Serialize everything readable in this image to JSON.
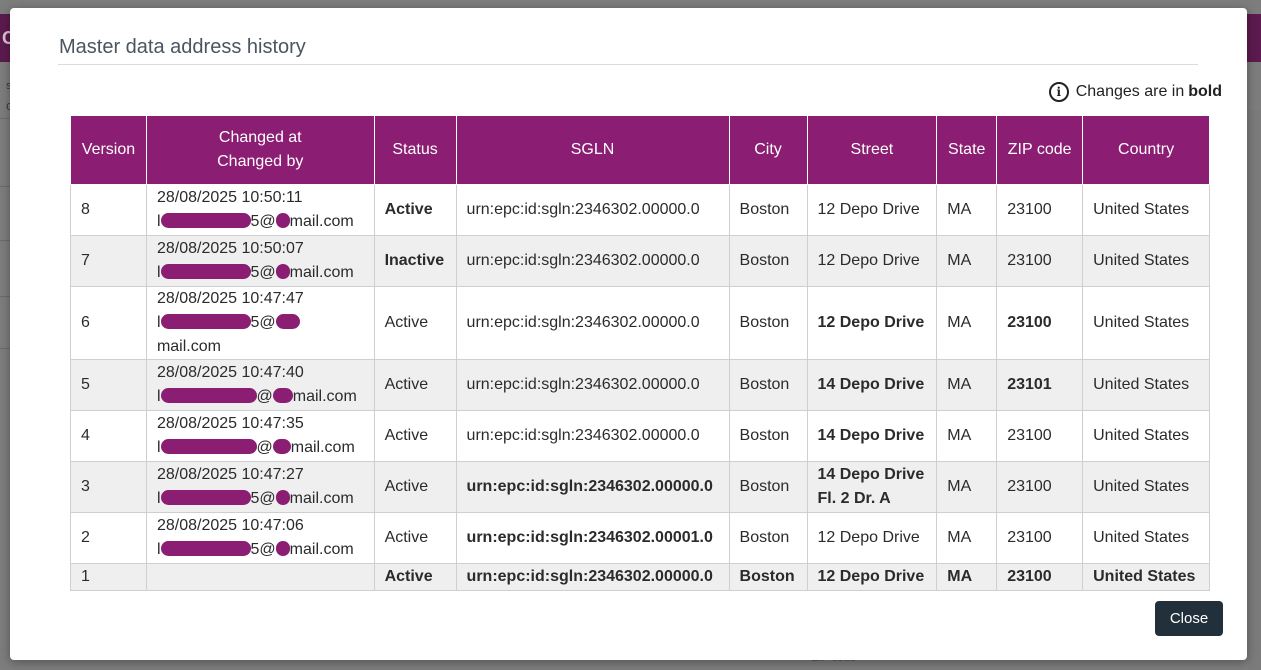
{
  "modal": {
    "title": "Master data address history",
    "legend_prefix": "Changes are in",
    "legend_bold": "bold",
    "close_label": "Close"
  },
  "background": {
    "header_letter": "C",
    "label_s": "s",
    "label_c": "c",
    "bottom_text": "ZIP code"
  },
  "table": {
    "headers": {
      "version": "Version",
      "changed_at": "Changed at",
      "changed_by": "Changed by",
      "status": "Status",
      "sgln": "SGLN",
      "city": "City",
      "street": "Street",
      "state": "State",
      "zip": "ZIP code",
      "country": "Country"
    },
    "rows": [
      {
        "version": "8",
        "changed_at": "28/08/2025 10:50:11",
        "changed_by_prefix": "l",
        "changed_by_suffix": "5@",
        "changed_by_domain": "mail.com",
        "status": "Active",
        "sgln": "urn:epc:id:sgln:2346302.00000.0",
        "city": "Boston",
        "street": "12 Depo Drive",
        "street2": "",
        "state": "MA",
        "zip": "23100",
        "country": "United States"
      },
      {
        "version": "7",
        "changed_at": "28/08/2025 10:50:07",
        "changed_by_prefix": "l",
        "changed_by_suffix": "5@",
        "changed_by_domain": "mail.com",
        "status": "Inactive",
        "sgln": "urn:epc:id:sgln:2346302.00000.0",
        "city": "Boston",
        "street": "12 Depo Drive",
        "street2": "",
        "state": "MA",
        "zip": "23100",
        "country": "United States"
      },
      {
        "version": "6",
        "changed_at": "28/08/2025 10:47:47",
        "changed_by_prefix": "l",
        "changed_by_suffix": "5@",
        "changed_by_domain": "mail.com",
        "status": "Active",
        "sgln": "urn:epc:id:sgln:2346302.00000.0",
        "city": "Boston",
        "street": "12 Depo Drive",
        "street2": "",
        "state": "MA",
        "zip": "23100",
        "country": "United States"
      },
      {
        "version": "5",
        "changed_at": "28/08/2025 10:47:40",
        "changed_by_prefix": "l",
        "changed_by_suffix": "@",
        "changed_by_domain": "mail.com",
        "status": "Active",
        "sgln": "urn:epc:id:sgln:2346302.00000.0",
        "city": "Boston",
        "street": "14 Depo Drive",
        "street2": "",
        "state": "MA",
        "zip": "23101",
        "country": "United States"
      },
      {
        "version": "4",
        "changed_at": "28/08/2025 10:47:35",
        "changed_by_prefix": "l",
        "changed_by_suffix": "@",
        "changed_by_domain": "mail.com",
        "status": "Active",
        "sgln": "urn:epc:id:sgln:2346302.00000.0",
        "city": "Boston",
        "street": "14 Depo Drive",
        "street2": "",
        "state": "MA",
        "zip": "23100",
        "country": "United States"
      },
      {
        "version": "3",
        "changed_at": "28/08/2025 10:47:27",
        "changed_by_prefix": "l",
        "changed_by_suffix": "5@",
        "changed_by_domain": "mail.com",
        "status": "Active",
        "sgln": "urn:epc:id:sgln:2346302.00000.0",
        "city": "Boston",
        "street": "14 Depo Drive",
        "street2": "Fl. 2 Dr. A",
        "state": "MA",
        "zip": "23100",
        "country": "United States"
      },
      {
        "version": "2",
        "changed_at": "28/08/2025 10:47:06",
        "changed_by_prefix": "l",
        "changed_by_suffix": "5@",
        "changed_by_domain": "mail.com",
        "status": "Active",
        "sgln": "urn:epc:id:sgln:2346302.00001.0",
        "city": "Boston",
        "street": "12 Depo Drive",
        "street2": "",
        "state": "MA",
        "zip": "23100",
        "country": "United States"
      },
      {
        "version": "1",
        "changed_at": "",
        "changed_by_prefix": "",
        "changed_by_suffix": "",
        "changed_by_domain": "",
        "status": "Active",
        "sgln": "urn:epc:id:sgln:2346302.00000.0",
        "city": "Boston",
        "street": "12 Depo Drive",
        "street2": "",
        "state": "MA",
        "zip": "23100",
        "country": "United States"
      }
    ]
  },
  "colors": {
    "header_bg": "#8b1d73",
    "redaction": "#8b1d73",
    "close_button": "#22303c",
    "stripe": "#efefef"
  },
  "icons": {
    "legend": "info-icon"
  }
}
